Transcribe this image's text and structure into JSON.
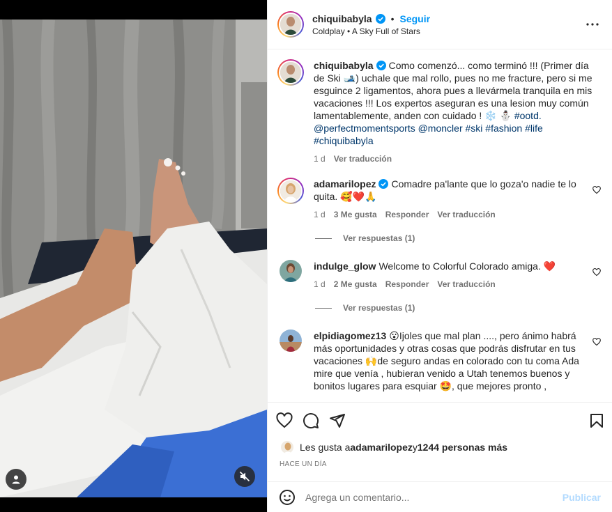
{
  "header": {
    "username": "chiquibabyla",
    "separator": "•",
    "follow_label": "Seguir",
    "song": "Coldplay • A Sky Full of Stars",
    "more_icon": "more-horizontal-icon"
  },
  "caption": {
    "username": "chiquibabyla",
    "text_part1": "Como comenzó... como terminó !!! (Primer día de Ski 🎿) uchale que mal rollo, pues no me fracture, pero si me esguince 2 ligamentos, ahora pues a llevármela tranquila en mis vacaciones !!! Los expertos aseguran es una lesion muy común lamentablemente, anden con cuidado ! ❄️ ⛄ ",
    "tags": "#ootd. @perfectmomentsports @moncler #ski #fashion #life #chiquibabyla",
    "age": "1 d",
    "translate": "Ver traducción"
  },
  "comments": [
    {
      "username": "adamarilopez",
      "text": "Comadre pa'lante que lo goza'o nadie te lo quita. 🥰❤️🙏",
      "age": "1 d",
      "likes": "3 Me gusta",
      "reply": "Responder",
      "translate": "Ver traducción",
      "replies": "Ver respuestas (1)"
    },
    {
      "username": "indulge_glow",
      "text": "Welcome to Colorful Colorado amiga. ❤️",
      "age": "1 d",
      "likes": "2 Me gusta",
      "reply": "Responder",
      "translate": "Ver traducción",
      "replies": "Ver respuestas (1)"
    },
    {
      "username": "elpidiagomez13",
      "text": "😮Ijoles que mal plan ...., pero ánimo habrá más oportunidades y otras cosas que podrás disfrutar en tus vacaciones 🙌de seguro andas en colorado con tu coma Ada mire que venía , hubieran venido a Utah tenemos buenos y bonitos lugares para esquiar 🤩, que mejores pronto ,"
    }
  ],
  "likes_line": {
    "prefix": "Les gusta a ",
    "user": "adamarilopez",
    "middle": " y ",
    "count": "1244 personas más"
  },
  "timestamp": "HACE UN DÍA",
  "add_comment": {
    "placeholder": "Agrega un comentario...",
    "post_label": "Publicar"
  },
  "colors": {
    "link_blue": "#0095f6",
    "tag_blue": "#00376b",
    "muted": "#737373",
    "heart_red": "#ed4956"
  }
}
